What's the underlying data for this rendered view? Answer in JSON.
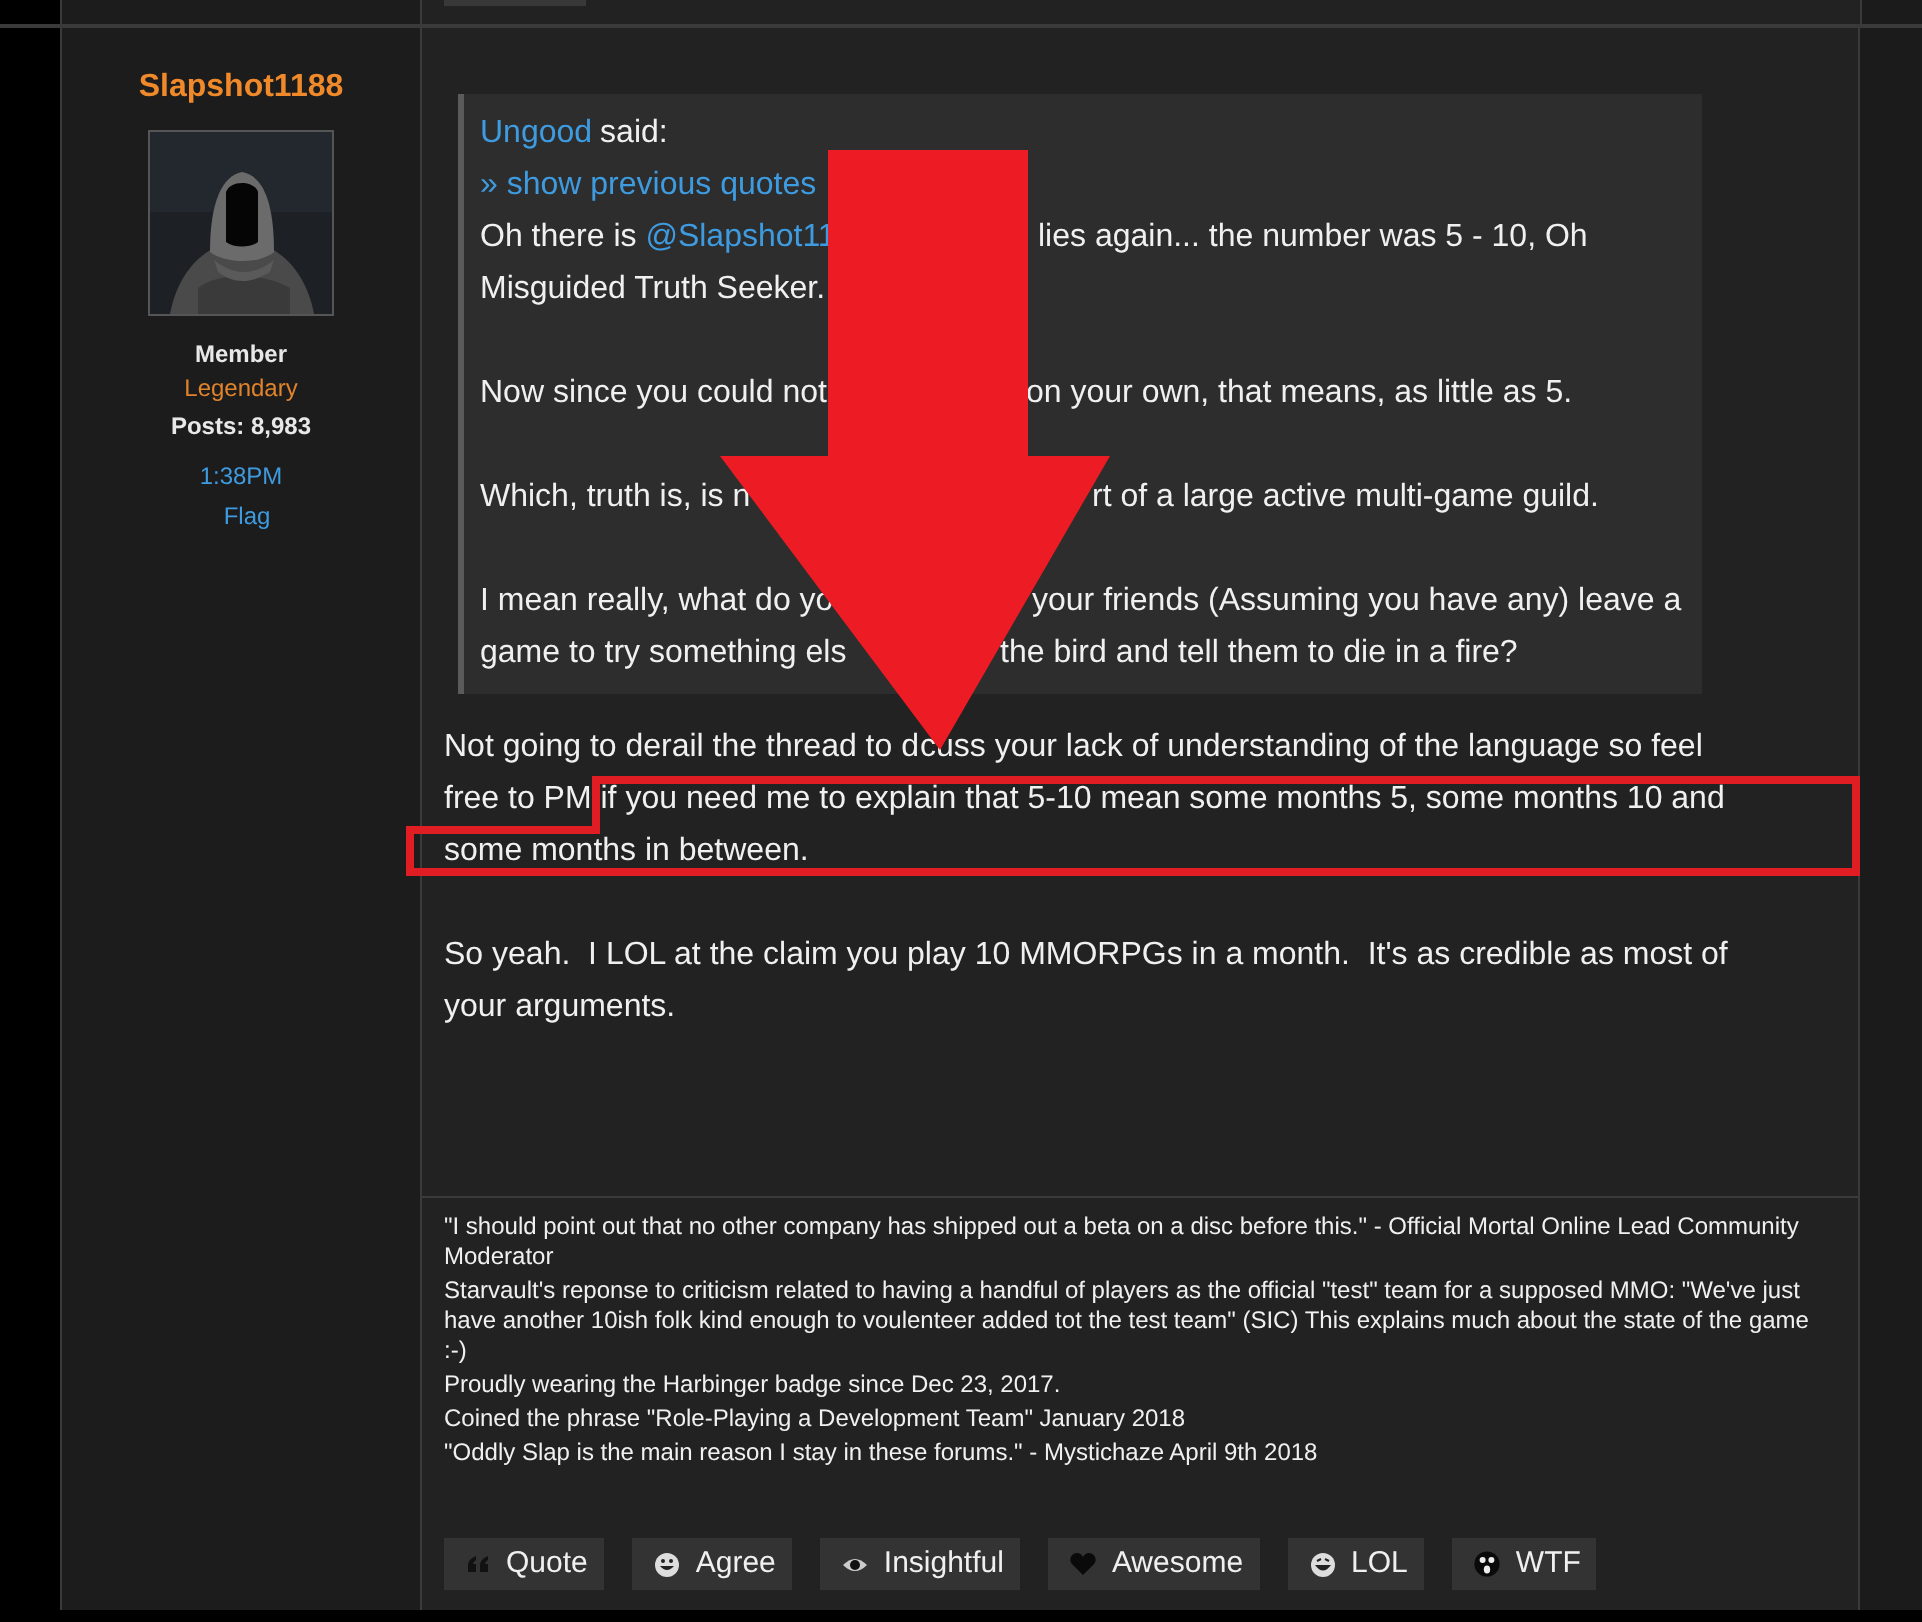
{
  "author": {
    "name": "Slapshot1188",
    "role": "Member",
    "rank": "Legendary",
    "posts_label": "Posts:",
    "posts": "8,983",
    "time": "1:38PM",
    "flag": "Flag"
  },
  "quote": {
    "author": "Ungood",
    "said": "said:",
    "show_previous": "» show previous quotes",
    "paragraphs": [
      [
        {
          "left": [
            {
              "kind": "text",
              "text": "Oh there is "
            },
            {
              "kind": "link",
              "text": "@Slapshot11"
            }
          ],
          "right": [
            {
              "kind": "text",
              "text": "lies again... the number was 5 - 10, Oh"
            }
          ]
        },
        {
          "left": [
            {
              "kind": "text",
              "text": "Misguided Truth Seeker."
            }
          ]
        }
      ],
      [
        {
          "left": [
            {
              "kind": "text",
              "text": "Now since you could not"
            }
          ],
          "right": [
            {
              "kind": "text",
              "text": "on your own, that means, as little as 5."
            }
          ]
        }
      ],
      [
        {
          "left": [
            {
              "kind": "text",
              "text": "Which, truth is, is n"
            }
          ],
          "right": [
            {
              "kind": "text",
              "text": "rt of a large active multi-game guild."
            }
          ]
        }
      ],
      [
        {
          "left": [
            {
              "kind": "text",
              "text": "I mean really, what do yo"
            }
          ],
          "right": [
            {
              "kind": "text",
              "text": "your friends (Assuming you have any) leave a"
            }
          ]
        },
        {
          "left": [
            {
              "kind": "text",
              "text": "game to try something els"
            }
          ],
          "right": [
            {
              "kind": "text",
              "text": "the bird and tell them to die in a fire?"
            }
          ]
        }
      ]
    ]
  },
  "body": [
    [
      {
        "left": [
          {
            "kind": "text",
            "text": "Not going to derail the thread to d"
          }
        ],
        "right": [
          {
            "kind": "text",
            "text": "cuss your lack of understanding of the language so feel"
          }
        ]
      },
      {
        "left": [
          {
            "kind": "text",
            "text": "free to PM if you need me to explain that 5-10 mean some months 5, some months 10 and"
          }
        ]
      },
      {
        "left": [
          {
            "kind": "text",
            "text": "some months in between."
          }
        ]
      }
    ],
    [
      {
        "left": [
          {
            "kind": "text",
            "text": "So yeah.  I LOL at the claim you play 10 MMORPGs in a month.  It's as credible as most of"
          }
        ]
      },
      {
        "left": [
          {
            "kind": "text",
            "text": "your arguments."
          }
        ]
      }
    ]
  ],
  "signature": [
    "\"I should point out that no other company has shipped out a beta on a disc before this.\" - Official Mortal Online Lead Community Moderator",
    "Starvault's reponse to criticism related to having a handful of players as the official \"test\" team for a supposed MMO: \"We've just have another 10ish folk kind enough to voulenteer added tot the test team\" (SIC) This explains much about the state of the game :-)",
    "Proudly wearing the Harbinger badge since Dec 23, 2017.",
    "Coined the phrase \"Role-Playing a Development Team\" January 2018",
    "\"Oddly Slap is the main reason I stay in these forums.\" - Mystichaze April 9th 2018"
  ],
  "reactions": [
    {
      "kind": "quote",
      "label": "Quote"
    },
    {
      "kind": "agree",
      "label": "Agree"
    },
    {
      "kind": "insightful",
      "label": "Insightful"
    },
    {
      "kind": "awesome",
      "label": "Awesome"
    },
    {
      "kind": "lol",
      "label": "LOL"
    },
    {
      "kind": "wtf",
      "label": "WTF"
    }
  ]
}
